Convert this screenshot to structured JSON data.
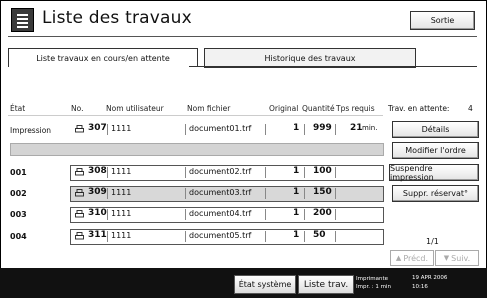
{
  "header": {
    "title": "Liste des travaux",
    "exit_label": "Sortie"
  },
  "tabs": [
    {
      "label": "Liste travaux en cours/en attente"
    },
    {
      "label": "Historique des travaux"
    }
  ],
  "table": {
    "columns": [
      "État",
      "No.",
      "Nom utilisateur",
      "Nom fichier",
      "Original",
      "Quantité",
      "Tps requis"
    ],
    "printing": {
      "state": "Impression",
      "no": "307",
      "user": "1111",
      "file": "document01.trf",
      "original": "1",
      "quantity": "999",
      "time": "21",
      "time_unit": "min."
    },
    "rows": [
      {
        "state": "001",
        "no": "308",
        "user": "1111",
        "file": "document02.trf",
        "original": "1",
        "quantity": "100",
        "time": ""
      },
      {
        "state": "002",
        "no": "309",
        "user": "1111",
        "file": "document03.trf",
        "original": "1",
        "quantity": "150",
        "time": ""
      },
      {
        "state": "003",
        "no": "310",
        "user": "1111",
        "file": "document04.trf",
        "original": "1",
        "quantity": "200",
        "time": ""
      },
      {
        "state": "004",
        "no": "311",
        "user": "1111",
        "file": "document05.trf",
        "original": "1",
        "quantity": "50",
        "time": ""
      }
    ]
  },
  "side": {
    "waiting_label": "Trav. en attente:",
    "waiting_count": "4",
    "details": "Détails",
    "modify_order": "Modifier l'ordre",
    "suspend": "Suspendre impression",
    "delete_reserved": "Suppr. réservat°",
    "page": "1/1",
    "prev": "Précd.",
    "next": "Suiv."
  },
  "footer": {
    "system_status": "État système",
    "job_list": "Liste trav.",
    "printer_label": "Imprimante",
    "printer_time": "Impr. : 1 min",
    "date": "19 APR 2006",
    "time": "10:16"
  }
}
